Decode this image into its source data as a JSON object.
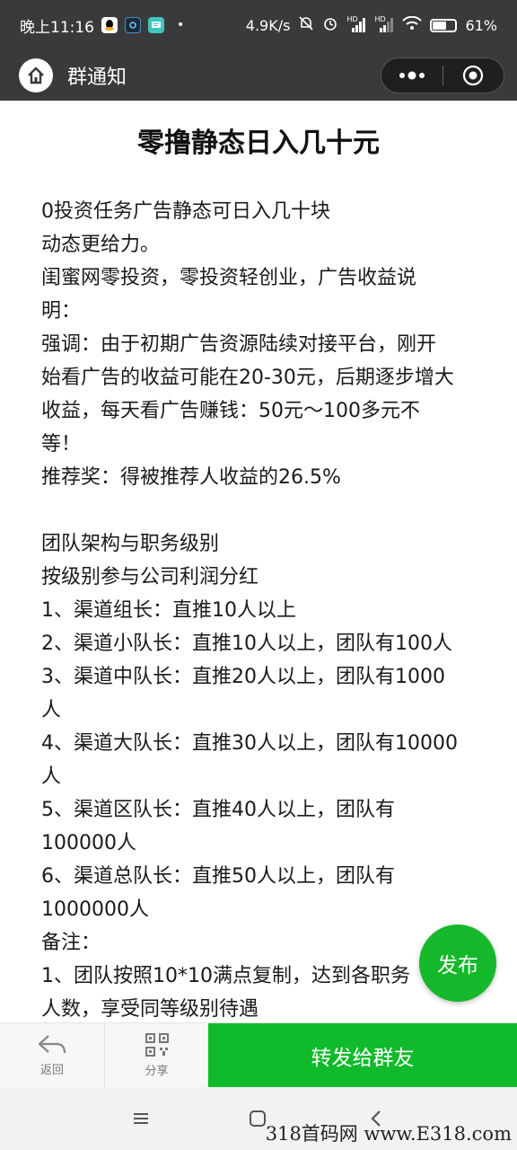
{
  "status_bar": {
    "time": "晚上11:16",
    "net_speed": "4.9K/s",
    "signal_label_1": "HD",
    "signal_label_2": "HD",
    "battery": "61",
    "battery_level": 0.61
  },
  "title_bar": {
    "title": "群通知"
  },
  "article": {
    "title": "零撸静态日入几十元",
    "lines": [
      "0投资任务广告静态可日入几十块",
      "动态更给力。",
      "闺蜜网零投资，零投资轻创业，广告收益说",
      "明：",
      "强调：由于初期广告资源陆续对接平台，刚开",
      "始看广告的收益可能在20-30元，后期逐步增大",
      "收益，每天看广告赚钱：50元～100多元不",
      "等！",
      "推荐奖：得被推荐人收益的26.5%",
      "",
      "团队架构与职务级别",
      "按级别参与公司利润分红",
      "1、渠道组长：直推10人以上",
      "2、渠道小队长：直推10人以上，团队有100人",
      "3、渠道中队长：直推20人以上，团队有1000",
      "人",
      "4、渠道大队长：直推30人以上，团队有10000",
      "人",
      "5、渠道区队长：直推40人以上，团队有",
      "100000人",
      "6、渠道总队长：直推50人以上，团队有",
      "1000000人",
      "备注：",
      "1、团队按照10*10满点复制，达到各职务",
      "人数，享受同等级别待遇"
    ]
  },
  "fab": {
    "label": "发布"
  },
  "bottom_bar": {
    "back_label": "返回",
    "share_label": "分享",
    "forward_label": "转发给群友"
  },
  "watermark": "318首码网  www.E318.com",
  "colors": {
    "header_bg": "#3a3a3c",
    "accent_green": "#0fbb2b",
    "fab_green": "#14b82a"
  }
}
